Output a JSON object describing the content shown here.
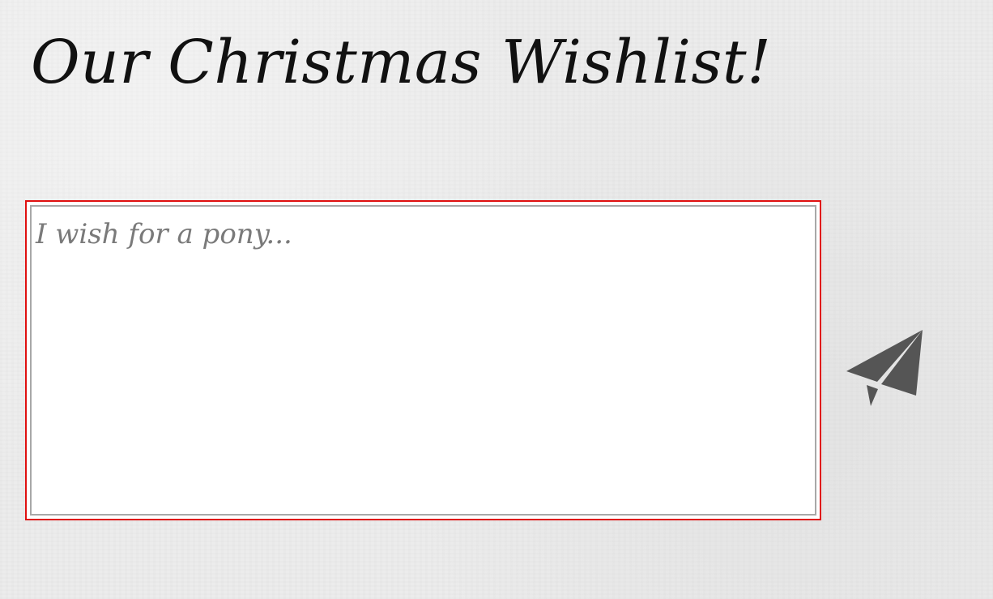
{
  "header": {
    "title": "Our Christmas Wishlist!"
  },
  "wish_form": {
    "textarea": {
      "value": "",
      "placeholder": "I wish for a pony..."
    },
    "send_button": {
      "icon": "paper-plane-icon"
    }
  },
  "colors": {
    "background": "#ececec",
    "focus_border": "#e01010",
    "inner_border": "#a8a8a8",
    "icon": "#555555",
    "title_text": "#111111",
    "placeholder_text": "#7a7a7a"
  }
}
